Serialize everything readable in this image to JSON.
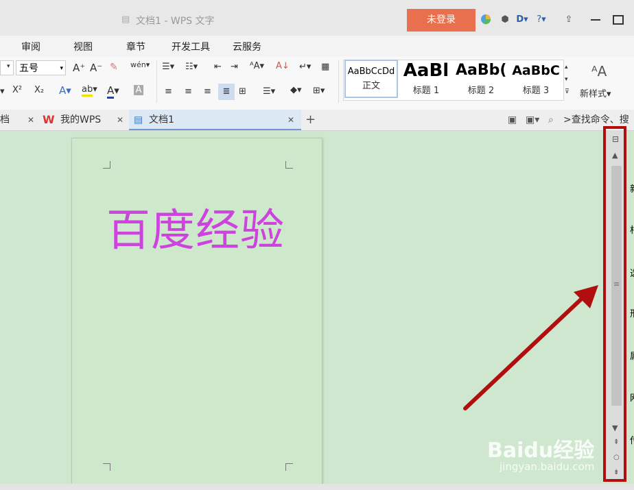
{
  "window": {
    "title": "文档1 - WPS 文字",
    "login_label": "未登录"
  },
  "menu": [
    "审阅",
    "视图",
    "章节",
    "开发工具",
    "云服务"
  ],
  "ribbon": {
    "font_size": "五号",
    "styles": [
      {
        "preview": "AaBbCcDd",
        "name": "正文"
      },
      {
        "preview": "AaBl",
        "name": "标题 1"
      },
      {
        "preview": "AaBb(",
        "name": "标题 2"
      },
      {
        "preview": "AaBbC",
        "name": "标题 3"
      }
    ],
    "new_style_label": "新样式"
  },
  "tabs": {
    "partial": "档",
    "my_wps": "我的WPS",
    "active": "文档1",
    "search_text": ">查找命令、搜"
  },
  "document": {
    "text": "百度经验"
  },
  "right_panel_chars": [
    "新",
    "相",
    "选",
    "形",
    "属",
    "网",
    "传"
  ],
  "watermark": {
    "logo": "Baidu经验",
    "url": "jingyan.baidu.com"
  },
  "colors": {
    "login_bg": "#e9704f",
    "doc_text": "#cc44dd",
    "highlight_frame": "#b10f0f",
    "arrow": "#b10f0f"
  }
}
